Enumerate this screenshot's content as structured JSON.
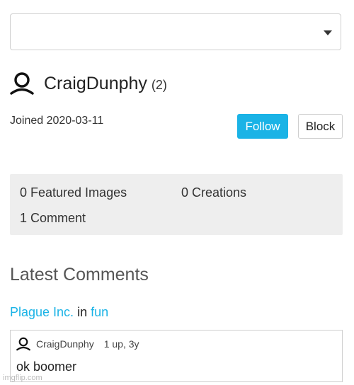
{
  "dropdown": {
    "selected": ""
  },
  "profile": {
    "username": "CraigDunphy",
    "count": "(2)",
    "joined": "Joined 2020-03-11",
    "follow_label": "Follow",
    "block_label": "Block"
  },
  "stats": {
    "featured": "0 Featured Images",
    "creations": "0 Creations",
    "comments": "1 Comment"
  },
  "latest": {
    "title": "Latest Comments",
    "image_title": "Plague Inc.",
    "in_label": "in",
    "stream": "fun",
    "comment": {
      "author": "CraigDunphy",
      "score": "1 up, 3y",
      "text": "ok boomer"
    }
  },
  "watermark": "imgflip.com",
  "colors": {
    "accent": "#1ab3e6",
    "stats_bg": "#eeeeee"
  },
  "icons": {
    "user": "user-icon",
    "dropdown": "chevron-down-icon"
  }
}
